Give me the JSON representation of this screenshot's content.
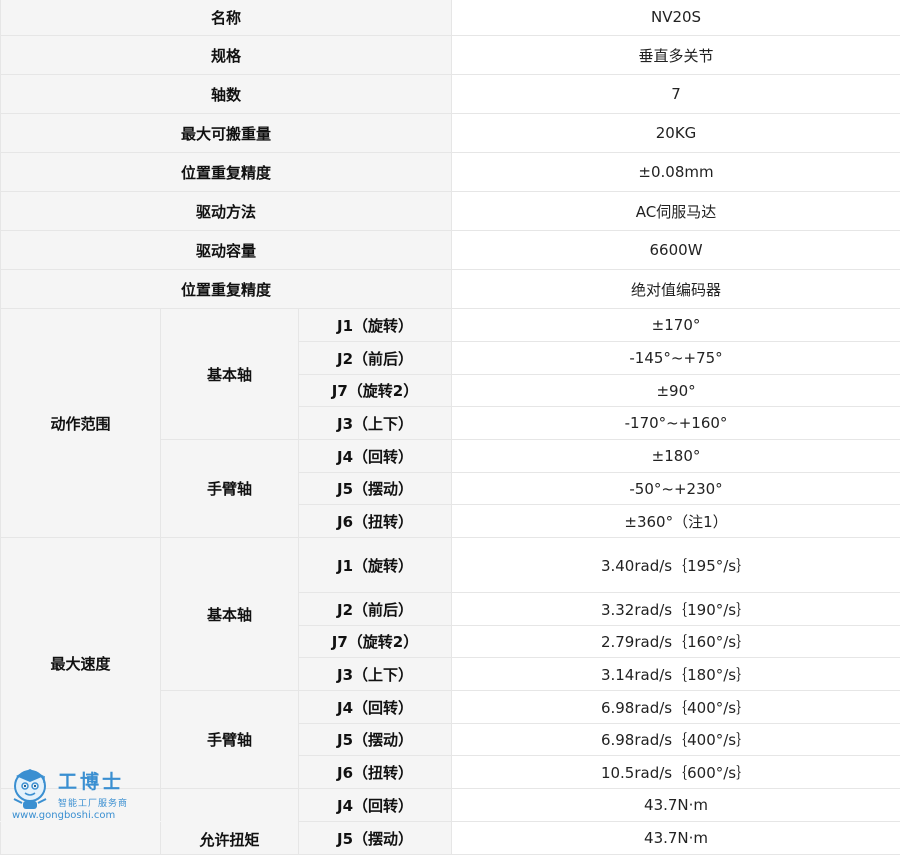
{
  "rows_simple": [
    {
      "label": "名称",
      "value": "NV20S"
    },
    {
      "label": "规格",
      "value": "垂直多关节"
    },
    {
      "label": "轴数",
      "value": "7"
    },
    {
      "label": "最大可搬重量",
      "value": "20KG"
    },
    {
      "label": "位置重复精度",
      "value": "±0.08mm"
    },
    {
      "label": "驱动方法",
      "value": "AC伺服马达"
    },
    {
      "label": "驱动容量",
      "value": "6600W"
    },
    {
      "label": "位置重复精度",
      "value": "绝对值编码器"
    }
  ],
  "motion_range": {
    "label": "动作范围",
    "basic_axis": {
      "label": "基本轴",
      "rows": [
        {
          "joint": "J1（旋转）",
          "value": "±170°"
        },
        {
          "joint": "J2（前后）",
          "value": "-145°~+75°"
        },
        {
          "joint": "J7（旋转2）",
          "value": "±90°"
        },
        {
          "joint": "J3（上下）",
          "value": "-170°~+160°"
        }
      ]
    },
    "wrist_axis": {
      "label": "手臂轴",
      "rows": [
        {
          "joint": "J4（回转）",
          "value": "±180°"
        },
        {
          "joint": "J5（摆动）",
          "value": "-50°~+230°"
        },
        {
          "joint": "J6（扭转）",
          "value": "±360°（注1）"
        }
      ]
    }
  },
  "max_speed": {
    "label": "最大速度",
    "basic_axis": {
      "label": "基本轴",
      "rows": [
        {
          "joint": "J1（旋转）",
          "value": "3.40rad/s｛195°/s｝"
        },
        {
          "joint": "J2（前后）",
          "value": "3.32rad/s｛190°/s｝"
        },
        {
          "joint": "J7（旋转2）",
          "value": "2.79rad/s｛160°/s｝"
        },
        {
          "joint": "J3（上下）",
          "value": "3.14rad/s｛180°/s｝"
        }
      ]
    },
    "wrist_axis": {
      "label": "手臂轴",
      "rows": [
        {
          "joint": "J4（回转）",
          "value": "6.98rad/s｛400°/s｝"
        },
        {
          "joint": "J5（摆动）",
          "value": "6.98rad/s｛400°/s｝"
        },
        {
          "joint": "J6（扭转）",
          "value": "10.5rad/s｛600°/s｝"
        }
      ]
    }
  },
  "allowable_torque": {
    "label": "允许扭矩",
    "rows": [
      {
        "joint": "J4（回转）",
        "value": "43.7N·m"
      },
      {
        "joint": "J5（摆动）",
        "value": "43.7N·m"
      }
    ]
  },
  "watermark": {
    "brand": "工博士",
    "subtitle": "智能工厂服务商",
    "url": "www.gongboshi.com",
    "color": "#3a8fd1"
  }
}
